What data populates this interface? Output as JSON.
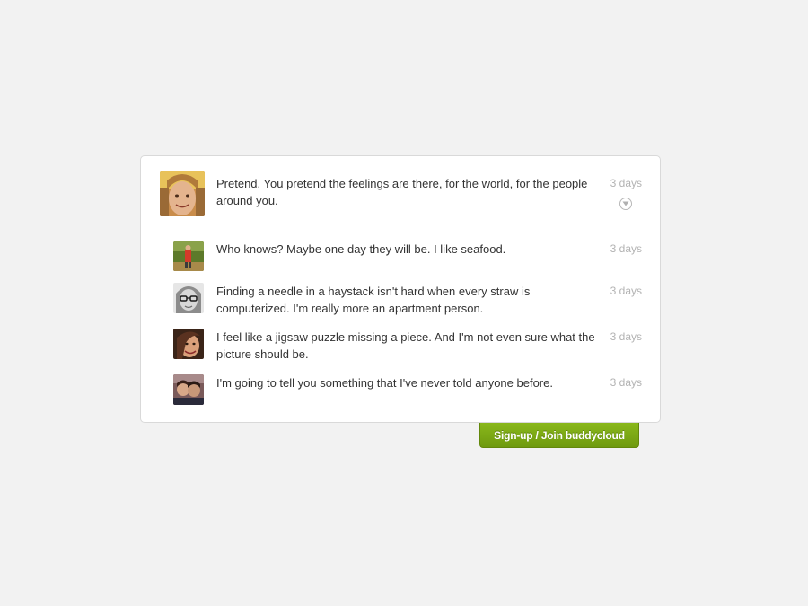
{
  "thread": {
    "main_post": {
      "text": "Pretend. You pretend the feelings are there, for the world, for the people around you.",
      "time": "3 days",
      "menu_icon": "chevron-down-circle-icon"
    },
    "replies": [
      {
        "text": "Who knows? Maybe one day they will be. I like seafood.",
        "time": "3 days"
      },
      {
        "text": "Finding a needle in a haystack isn't hard when every straw is computerized. I'm really more an apartment person.",
        "time": "3 days"
      },
      {
        "text": "I feel like a jigsaw puzzle missing a piece. And I'm not even sure what the picture should be.",
        "time": "3 days"
      },
      {
        "text": "I'm going to tell you something that I've never told anyone before.",
        "time": "3 days"
      }
    ]
  },
  "signup": {
    "label": "Sign-up / Join buddycloud"
  },
  "colors": {
    "background": "#f2f2f2",
    "card": "#ffffff",
    "accent_green": "#7aa816",
    "muted_text": "#b3b3b3"
  }
}
